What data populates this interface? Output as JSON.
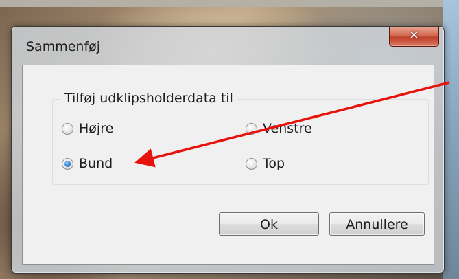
{
  "dialog": {
    "title": "Sammenføj",
    "close_glyph": "✕",
    "group_title": "Tilføj udklipsholderdata til",
    "options": [
      {
        "label": "Højre",
        "checked": false
      },
      {
        "label": "Venstre",
        "checked": false
      },
      {
        "label": "Bund",
        "checked": true
      },
      {
        "label": "Top",
        "checked": false
      }
    ],
    "ok_label": "Ok",
    "cancel_label": "Annullere"
  },
  "annotation": {
    "arrow_color": "#e8120c"
  },
  "colors": {
    "close_button": "#c0402a",
    "radio_selected": "#2a78c8",
    "dialog_background": "#f0f0f0"
  }
}
